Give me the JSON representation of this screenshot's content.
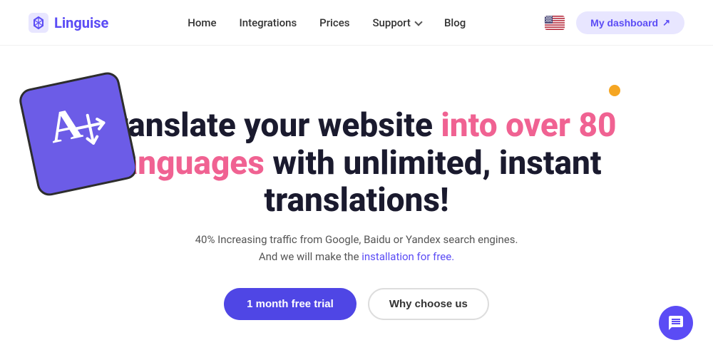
{
  "nav": {
    "logo_text": "Linguise",
    "links": [
      {
        "label": "Home",
        "id": "home"
      },
      {
        "label": "Integrations",
        "id": "integrations"
      },
      {
        "label": "Prices",
        "id": "prices"
      },
      {
        "label": "Support",
        "id": "support",
        "has_dropdown": true
      },
      {
        "label": "Blog",
        "id": "blog"
      }
    ],
    "dashboard_label": "My dashboard",
    "flag_alt": "US Flag"
  },
  "hero": {
    "title_part1": "Translate your website ",
    "title_part2": "into over 80 languages",
    "title_part3": " with unlimited, instant translations!",
    "subtitle_line1": "40% Increasing traffic from Google, Baidu or Yandex search engines.",
    "subtitle_line2": "And we will make the ",
    "subtitle_link": "installation for free.",
    "btn_primary": "1 month free trial",
    "btn_secondary": "Why choose us"
  },
  "chat": {
    "aria_label": "Open chat"
  }
}
